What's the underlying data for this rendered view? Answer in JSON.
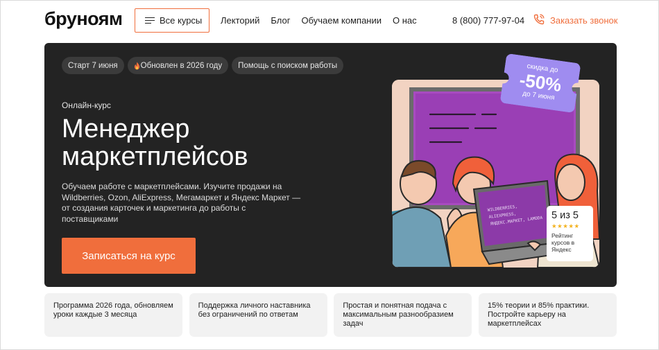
{
  "header": {
    "logo": "бруноям",
    "all_courses_label": "Все курсы",
    "nav": [
      "Лекторий",
      "Блог",
      "Обучаем компании",
      "О нас"
    ],
    "phone": "8 (800) 777-97-04",
    "callback_label": "Заказать звонок"
  },
  "hero": {
    "tags": [
      "Старт 7 июня",
      "Обновлен в 2026 году",
      "Помощь с поиском работы"
    ],
    "eyebrow": "Онлайн-курс",
    "title": "Менеджер маркетплейсов",
    "description": "Обучаем работе с маркетплейсами. Изучите продажи на Wildberries, Ozon, AliExpress, Мегамаркет и Яндекс Маркет — от создания карточек и маркетинга до работы с поставщиками",
    "cta_label": "Записаться на курс",
    "discount": {
      "top": "скидка до",
      "value": "-50%",
      "bottom": "до 7 июня"
    },
    "rating": {
      "score": "5 из 5",
      "stars": "★★★★★",
      "caption": "Рейтинг курсов в Яндекс"
    },
    "screen_text": [
      "WILDBERRIES,",
      "ALIEXPRESS,",
      "ЯНДЕКС.МАРКЕТ, LAMODA"
    ]
  },
  "features": [
    "Программа 2026 года, обновляем уроки каждые 3 месяца",
    "Поддержка личного наставника без ограничений по ответам",
    "Простая и понятная подача с максимальным разнообразием задач",
    "15% теории и 85% практики. Постройте карьеру на маркетплейсах"
  ],
  "colors": {
    "accent": "#f06e3c",
    "hero_bg": "#232323",
    "ticket": "#9f8cf0",
    "illustration_purple": "#9a3fb5"
  }
}
